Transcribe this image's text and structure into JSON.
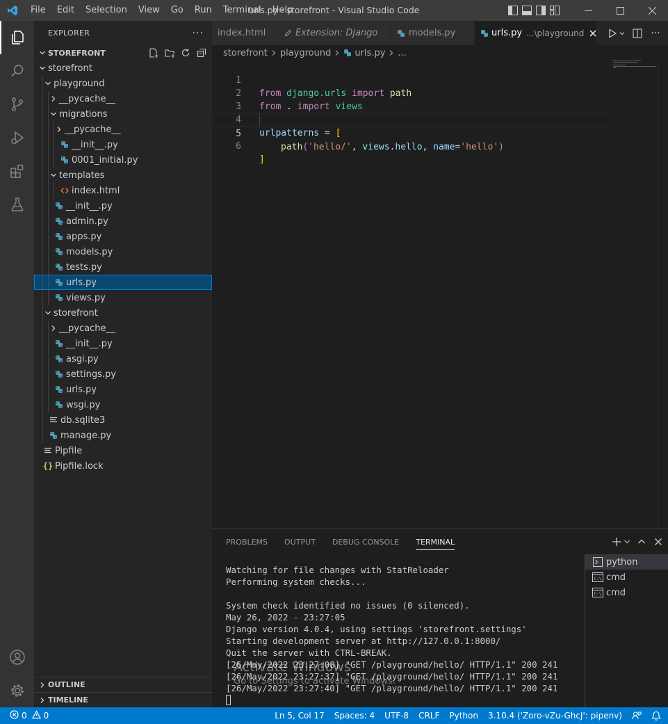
{
  "titlebar": {
    "title": "urls.py - storefront - Visual Studio Code",
    "menu": [
      "File",
      "Edit",
      "Selection",
      "View",
      "Go",
      "Run",
      "Terminal",
      "Help"
    ]
  },
  "sidebar": {
    "header": "EXPLORER",
    "project": "STOREFRONT",
    "tree": [
      {
        "label": "storefront",
        "type": "folder"
      },
      {
        "label": "playground",
        "type": "folder"
      },
      {
        "label": "__pycache__",
        "type": "folder-collapsed"
      },
      {
        "label": "migrations",
        "type": "folder"
      },
      {
        "label": "__pycache__",
        "type": "folder-collapsed"
      },
      {
        "label": "__init__.py",
        "type": "python"
      },
      {
        "label": "0001_initial.py",
        "type": "python"
      },
      {
        "label": "templates",
        "type": "folder"
      },
      {
        "label": "index.html",
        "type": "html"
      },
      {
        "label": "__init__.py",
        "type": "python"
      },
      {
        "label": "admin.py",
        "type": "python"
      },
      {
        "label": "apps.py",
        "type": "python"
      },
      {
        "label": "models.py",
        "type": "python"
      },
      {
        "label": "tests.py",
        "type": "python"
      },
      {
        "label": "urls.py",
        "type": "python"
      },
      {
        "label": "views.py",
        "type": "python"
      },
      {
        "label": "storefront",
        "type": "folder"
      },
      {
        "label": "__pycache__",
        "type": "folder-collapsed"
      },
      {
        "label": "__init__.py",
        "type": "python"
      },
      {
        "label": "asgi.py",
        "type": "python"
      },
      {
        "label": "settings.py",
        "type": "python"
      },
      {
        "label": "urls.py",
        "type": "python"
      },
      {
        "label": "wsgi.py",
        "type": "python"
      },
      {
        "label": "db.sqlite3",
        "type": "file"
      },
      {
        "label": "manage.py",
        "type": "python"
      },
      {
        "label": "Pipfile",
        "type": "file"
      },
      {
        "label": "Pipfile.lock",
        "type": "json"
      }
    ],
    "outline": "OUTLINE",
    "timeline": "TIMELINE"
  },
  "tabs": [
    {
      "label": "index.html"
    },
    {
      "label": "Extension: Django"
    },
    {
      "label": "models.py"
    },
    {
      "label": "urls.py",
      "desc": "...\\playground"
    }
  ],
  "breadcrumb": [
    "storefront",
    "playground",
    "urls.py",
    "..."
  ],
  "editor": {
    "line_numbers": [
      "1",
      "2",
      "3",
      "4",
      "5",
      "6"
    ],
    "line1": {
      "kw1": "from",
      "mod": "django.urls",
      "kw2": "import",
      "name": "path"
    },
    "line2": {
      "kw1": "from",
      "dot": " . ",
      "kw2": "import",
      "name": "views"
    },
    "line4": {
      "var": "urlpatterns",
      "op": " = ",
      "br": "["
    },
    "line5": {
      "fn": "path",
      "open": "(",
      "str1": "'hello/'",
      "sep1": ", ",
      "obj": "views",
      "dot": ".",
      "attr": "hello",
      "sep2": ", ",
      "kwarg": "name",
      "eq": "=",
      "str2": "'hello'",
      "close": ")"
    },
    "line6": {
      "br": "]"
    }
  },
  "panel": {
    "tabs": [
      "PROBLEMS",
      "OUTPUT",
      "DEBUG CONSOLE",
      "TERMINAL"
    ],
    "terminal_lines": [
      "Watching for file changes with StatReloader",
      "Performing system checks...",
      "",
      "System check identified no issues (0 silenced).",
      "May 26, 2022 - 23:27:05",
      "Django version 4.0.4, using settings 'storefront.settings'",
      "Starting development server at http://127.0.0.1:8000/",
      "Quit the server with CTRL-BREAK.",
      "[26/May/2022 23:27:08] \"GET /playground/hello/ HTTP/1.1\" 200 241",
      "[26/May/2022 23:27:37] \"GET /playground/hello/ HTTP/1.1\" 200 241",
      "[26/May/2022 23:27:40] \"GET /playground/hello/ HTTP/1.1\" 200 241"
    ],
    "terminal_list": [
      "python",
      "cmd",
      "cmd"
    ],
    "watermark": "Activate Windows",
    "watermark_sub": "Go to Settings to activate Windows."
  },
  "statusbar": {
    "errors": "0",
    "warnings": "0",
    "position": "Ln 5, Col 17",
    "spaces": "Spaces: 4",
    "encoding": "UTF-8",
    "eol": "CRLF",
    "language": "Python",
    "interpreter": "3.10.4 ('Zoro-vZu-GhcJ': pipenv)"
  },
  "colors": {
    "accent": "#007acc",
    "selection": "#094771",
    "python_icon": "#519aba",
    "html_icon": "#e37933",
    "json_icon": "#cbcb41"
  }
}
